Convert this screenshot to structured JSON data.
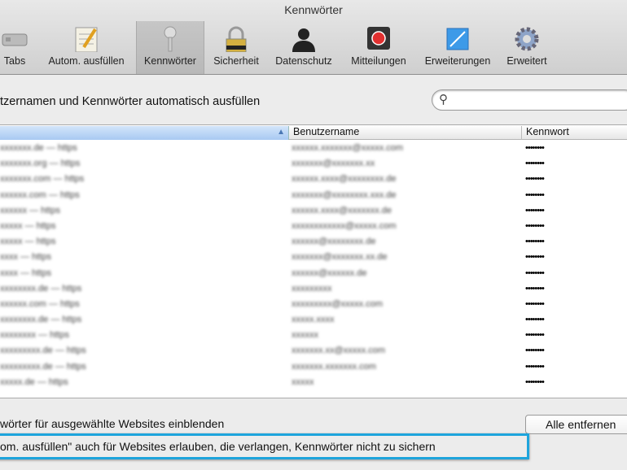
{
  "window": {
    "title": "Kennwörter"
  },
  "toolbar": [
    {
      "label": "Tabs",
      "icon": "tabs-icon"
    },
    {
      "label": "Autom. ausfüllen",
      "icon": "autofill-icon"
    },
    {
      "label": "Kennwörter",
      "icon": "key-icon",
      "selected": true
    },
    {
      "label": "Sicherheit",
      "icon": "lock-icon"
    },
    {
      "label": "Datenschutz",
      "icon": "person-icon"
    },
    {
      "label": "Mitteilungen",
      "icon": "notification-icon"
    },
    {
      "label": "Erweiterungen",
      "icon": "extensions-icon"
    },
    {
      "label": "Erweitert",
      "icon": "gear-icon"
    }
  ],
  "main": {
    "heading": "tzernamen und Kennwörter automatisch ausfüllen",
    "search": {
      "icon": "search-icon",
      "value": "",
      "glyph": "⚲"
    },
    "table": {
      "headers": [
        "",
        "Benutzername",
        "Kennwort"
      ],
      "sort_arrow": "▲",
      "rows": [
        {
          "site": "xxxxxxx.de — https",
          "user": "xxxxxx.xxxxxxx@xxxxx.com",
          "pw": "••••••••"
        },
        {
          "site": "xxxxxxx.org — https",
          "user": "xxxxxxx@xxxxxxx.xx",
          "pw": "••••••••"
        },
        {
          "site": "xxxxxxx.com — https",
          "user": "xxxxxx.xxxx@xxxxxxxx.de",
          "pw": "••••••••"
        },
        {
          "site": "xxxxxx.com — https",
          "user": "xxxxxxx@xxxxxxxx.xxx.de",
          "pw": "••••••••"
        },
        {
          "site": "xxxxxx — https",
          "user": "xxxxxx.xxxx@xxxxxxx.de",
          "pw": "••••••••"
        },
        {
          "site": "xxxxx — https",
          "user": "xxxxxxxxxxxx@xxxxx.com",
          "pw": "••••••••"
        },
        {
          "site": "xxxxx — https",
          "user": "xxxxxx@xxxxxxxx.de",
          "pw": "••••••••"
        },
        {
          "site": "xxxx — https",
          "user": "xxxxxxx@xxxxxxx.xx.de",
          "pw": "••••••••"
        },
        {
          "site": "xxxx — https",
          "user": "xxxxxx@xxxxxx.de",
          "pw": "••••••••"
        },
        {
          "site": "xxxxxxxx.de — https",
          "user": "xxxxxxxxx",
          "pw": "••••••••"
        },
        {
          "site": "xxxxxx.com — https",
          "user": "xxxxxxxxx@xxxxx.com",
          "pw": "••••••••"
        },
        {
          "site": "xxxxxxxx.de — https",
          "user": "xxxxx.xxxx",
          "pw": "••••••••"
        },
        {
          "site": "xxxxxxxx — https",
          "user": "xxxxxx",
          "pw": "••••••••"
        },
        {
          "site": "xxxxxxxxx.de — https",
          "user": "xxxxxxx.xx@xxxxx.com",
          "pw": "••••••••"
        },
        {
          "site": "xxxxxxxxx.de — https",
          "user": "xxxxxxx.xxxxxxx.com",
          "pw": "••••••••"
        },
        {
          "site": "xxxxx.de — https",
          "user": "xxxxx",
          "pw": "••••••••"
        }
      ]
    },
    "show_passwords_label": "wörter für ausgewählte Websites einblenden",
    "remove_all_button": "Alle entfernen",
    "allow_autofill_label": "om. ausfüllen\" auch für Websites erlauben, die verlangen, Kennwörter nicht zu sichern",
    "highlight_color": "#1ea4dc"
  }
}
